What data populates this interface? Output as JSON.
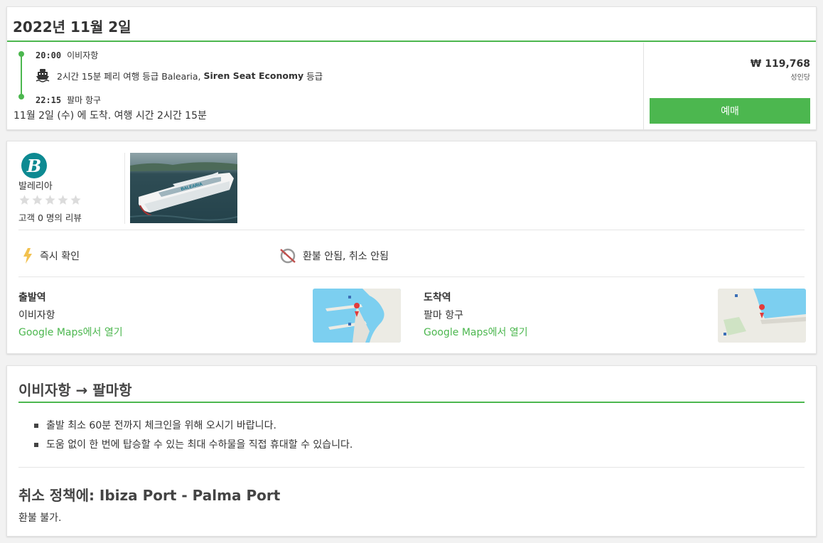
{
  "trip": {
    "date": "2022년 11월 2일",
    "departure_time": "20:00",
    "departure_port": "이비자항",
    "duration_text": "2시간 15분 페리 여행 등급 Balearia, ",
    "class_name": "Siren Seat Economy",
    "class_suffix": " 등급",
    "arrival_time": "22:15",
    "arrival_port": "팔마 항구",
    "arrival_summary": "11월 2일 (수) 에 도착. 여행 시간 2시간 15분",
    "price": "₩ 119,768",
    "price_unit": "성인당",
    "book_label": "예매",
    "ship_icon": "ship-icon"
  },
  "operator": {
    "logo_letter": "B",
    "name": "발레리아",
    "rating": 0,
    "rating_max": 5,
    "reviews_text": "고객 0 명의 리뷰",
    "ship_livery_text": "BALEARIA"
  },
  "features": {
    "instant": "즉시 확인",
    "refund": "환불 안됨, 취소 안됨"
  },
  "stations": {
    "departure_title": "출발역",
    "departure_name": "이비자항",
    "departure_link": "Google Maps에서 열기",
    "arrival_title": "도착역",
    "arrival_name": "팔마 항구",
    "arrival_link": "Google Maps에서 열기"
  },
  "info": {
    "route_title": "이비자항 → 팔마항",
    "notes": [
      "출발 최소 60분 전까지 체크인을 위해 오시기 바랍니다.",
      "도움 없이 한 번에 탑승할 수 있는 최대 수하물을 직접 휴대할 수 있습니다."
    ],
    "policy_title": "취소 정책에: Ibiza Port - Palma Port",
    "policy_text": "환불 불가."
  },
  "colors": {
    "accent": "#4cb74f",
    "logo": "#0d8a92",
    "map_water": "#7ccff0",
    "lightning": "#f2c14e"
  }
}
